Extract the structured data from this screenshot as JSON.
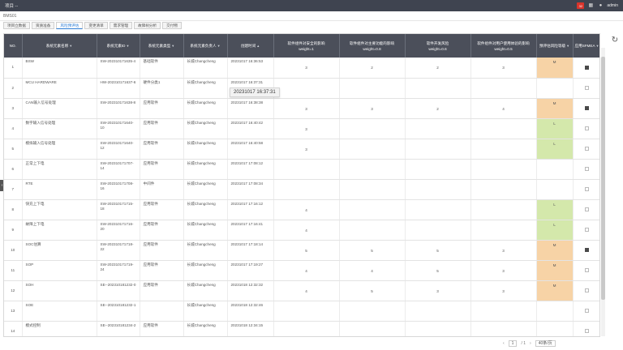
{
  "app": {
    "title": "项目 --",
    "badge": "32",
    "user": "admin"
  },
  "project_name": "BMS01",
  "tabs": [
    {
      "label": "项目立数据",
      "active": false
    },
    {
      "label": "资质准备",
      "active": false
    },
    {
      "label": "风险预评估",
      "active": true
    },
    {
      "label": "变更清单",
      "active": false
    },
    {
      "label": "需求管理",
      "active": false
    },
    {
      "label": "故障树分析",
      "active": false
    },
    {
      "label": "交付物",
      "active": false
    }
  ],
  "table": {
    "headers": [
      {
        "label": "NO.",
        "filter": false
      },
      {
        "label": "系统元素名称",
        "filter": true
      },
      {
        "label": "系统元素ID",
        "filter": true
      },
      {
        "label": "系统元素类型",
        "filter": true
      },
      {
        "label": "系统元素负责人",
        "filter": true
      },
      {
        "label": "创建时间",
        "filter": false,
        "sort": "▲"
      },
      {
        "label": "软件组件对安全的影响",
        "sub": "weight=1",
        "filter": false
      },
      {
        "label": "软件组件对主要功能的影响",
        "sub": "weight=0.8",
        "filter": false
      },
      {
        "label": "软件开发风险",
        "sub": "weight=0.6",
        "filter": false
      },
      {
        "label": "软件组件对用户使用体验的影响",
        "sub": "weight=0.5",
        "filter": false
      },
      {
        "label": "预评估风险等级",
        "filter": true
      },
      {
        "label": "应用SFMEA",
        "filter": true
      }
    ],
    "rows": [
      {
        "no": "1",
        "name": "BSW",
        "id": "SW-202310171635-4",
        "type": "基础软件",
        "owner": "长城Changcheng",
        "time": "20231017 16:36:53",
        "w1": "3",
        "w2": "2",
        "w3": "2",
        "w4": "3",
        "risk": "M",
        "sfmea": true
      },
      {
        "no": "2",
        "name": "MCU HARDWARE",
        "id": "HW-202310171637-6",
        "type": "硬件分类1",
        "owner": "长城Changcheng",
        "time": "20231017 16:37:31",
        "w1": "",
        "w2": "",
        "w3": "",
        "w4": "",
        "risk": "",
        "sfmea": false
      },
      {
        "no": "3",
        "name": "CAN输入信号处理",
        "id": "SW-202310171638-8",
        "type": "应用软件",
        "owner": "长城Changcheng",
        "time": "20231017 16:38:38",
        "w1": "3",
        "w2": "3",
        "w3": "2",
        "w4": "4",
        "risk": "M",
        "sfmea": true
      },
      {
        "no": "4",
        "name": "数字输入信号处理",
        "id": "SW-202310171640-10",
        "type": "应用软件",
        "owner": "长城Changcheng",
        "time": "20231017 16:40:42",
        "w1": "3",
        "w2": "",
        "w3": "",
        "w4": "",
        "risk": "L",
        "sfmea": false
      },
      {
        "no": "5",
        "name": "模拟输入信号处理",
        "id": "SW-202310171640-12",
        "type": "应用软件",
        "owner": "长城Changcheng",
        "time": "20231017 16:40:58",
        "w1": "3",
        "w2": "",
        "w3": "",
        "w4": "",
        "risk": "L",
        "sfmea": false
      },
      {
        "no": "6",
        "name": "正常上下电",
        "id": "SW-202310171707-14",
        "type": "应用软件",
        "owner": "长城Changcheng",
        "time": "20231017 17:08:12",
        "w1": "",
        "w2": "",
        "w3": "",
        "w4": "",
        "risk": "",
        "sfmea": false
      },
      {
        "no": "7",
        "name": "RTE",
        "id": "SW-202310171708-16",
        "type": "中间件",
        "owner": "长城Changcheng",
        "time": "20231017 17:08:34",
        "w1": "",
        "w2": "",
        "w3": "",
        "w4": "",
        "risk": "",
        "sfmea": false
      },
      {
        "no": "8",
        "name": "快充上下电",
        "id": "SW-202310171715-18",
        "type": "应用软件",
        "owner": "长城Changcheng",
        "time": "20231017 17:16:12",
        "w1": "4",
        "w2": "",
        "w3": "",
        "w4": "",
        "risk": "L",
        "sfmea": false
      },
      {
        "no": "9",
        "name": "故障上下电",
        "id": "SW-202310171716-20",
        "type": "应用软件",
        "owner": "长城Changcheng",
        "time": "20231017 17:16:41",
        "w1": "4",
        "w2": "",
        "w3": "",
        "w4": "",
        "risk": "L",
        "sfmea": false
      },
      {
        "no": "10",
        "name": "SOC估算",
        "id": "SW-202310171718-22",
        "type": "应用软件",
        "owner": "长城Changcheng",
        "time": "20231017 17:18:14",
        "w1": "5",
        "w2": "5",
        "w3": "5",
        "w4": "3",
        "risk": "M",
        "sfmea": true
      },
      {
        "no": "11",
        "name": "SOP",
        "id": "SW-202310171719-24",
        "type": "应用软件",
        "owner": "长城Changcheng",
        "time": "20231017 17:19:27",
        "w1": "4",
        "w2": "4",
        "w3": "5",
        "w4": "3",
        "risk": "M",
        "sfmea": false
      },
      {
        "no": "12",
        "name": "SOH",
        "id": "SE--202310181232-0",
        "type": "应用软件",
        "owner": "长城Changcheng",
        "time": "20231018 12:32:32",
        "w1": "4",
        "w2": "5",
        "w3": "3",
        "w4": "3",
        "risk": "M",
        "sfmea": false
      },
      {
        "no": "13",
        "name": "SOE",
        "id": "SE--202310181232-1",
        "type": "",
        "owner": "长城Changcheng",
        "time": "20231018 12:32:46",
        "w1": "",
        "w2": "",
        "w3": "",
        "w4": "",
        "risk": "",
        "sfmea": false
      },
      {
        "no": "14",
        "name": "模式控制",
        "id": "SE--202310181234-2",
        "type": "应用软件",
        "owner": "长城Changcheng",
        "time": "20231018 12:34:15",
        "w1": "",
        "w2": "",
        "w3": "",
        "w4": "",
        "risk": "",
        "sfmea": false
      }
    ]
  },
  "tooltip": "20231017 16:37:31",
  "pager": {
    "page": "1",
    "total": "/ 1",
    "page_size": "40条/页"
  }
}
